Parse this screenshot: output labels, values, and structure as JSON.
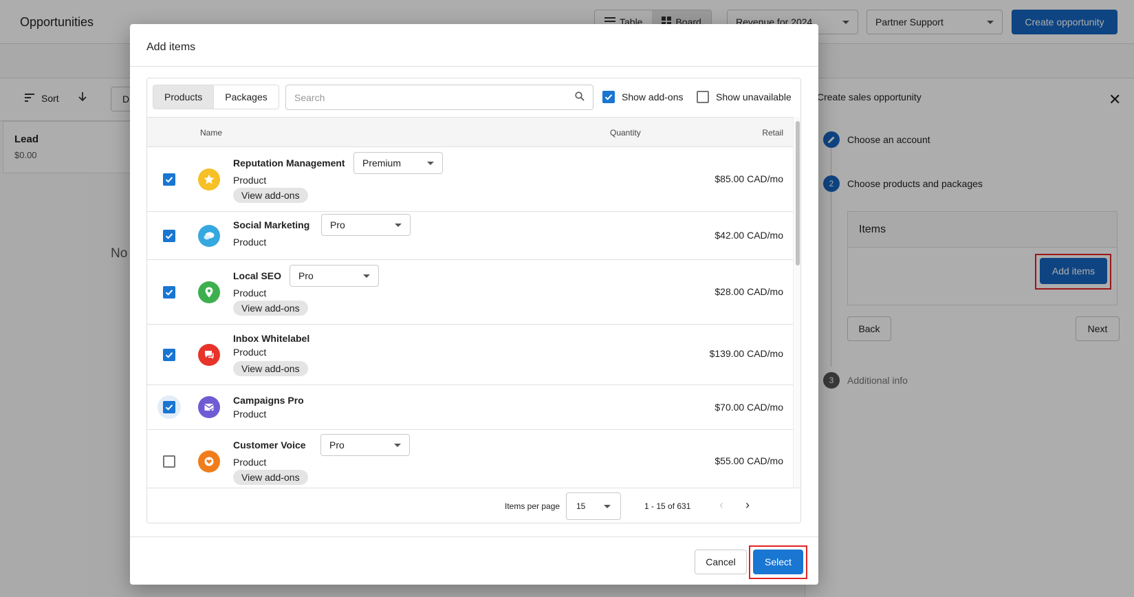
{
  "page": {
    "title": "Opportunities",
    "view_table": "Table",
    "view_board": "Board",
    "revenue_select": "Revenue for 2024",
    "team_select": "Partner Support",
    "create_button": "Create opportunity",
    "sort_label": "Sort",
    "filter_stub": "D",
    "lead_title": "Lead",
    "lead_amount": "$0.00",
    "empty_text": "No"
  },
  "side_panel": {
    "title": "Create sales opportunity",
    "steps": [
      {
        "number": "",
        "label": "Choose an account"
      },
      {
        "number": "2",
        "label": "Choose products and packages"
      },
      {
        "number": "3",
        "label": "Additional info"
      }
    ],
    "items_heading": "Items",
    "add_items_button": "Add items",
    "back_button": "Back",
    "next_button": "Next"
  },
  "modal": {
    "title": "Add items",
    "tabs": [
      "Products",
      "Packages"
    ],
    "search_placeholder": "Search",
    "show_addons_label": "Show add-ons",
    "show_addons_checked": true,
    "show_unavailable_label": "Show unavailable",
    "show_unavailable_checked": false,
    "columns": {
      "name": "Name",
      "quantity": "Quantity",
      "retail": "Retail"
    },
    "rows": [
      {
        "name": "Reputation Management",
        "type": "Product",
        "tier": "Premium",
        "addons": "View add-ons",
        "price": "$85.00 CAD/mo",
        "checked": true,
        "icon": "star-icon",
        "color": "#f6c026"
      },
      {
        "name": "Social Marketing",
        "type": "Product",
        "tier": "Pro",
        "addons": "",
        "price": "$42.00 CAD/mo",
        "checked": true,
        "icon": "chat-bubbles-icon",
        "color": "#35a8e0"
      },
      {
        "name": "Local SEO",
        "type": "Product",
        "tier": "Pro",
        "addons": "View add-ons",
        "price": "$28.00 CAD/mo",
        "checked": true,
        "icon": "map-pin-icon",
        "color": "#3daf4f"
      },
      {
        "name": "Inbox Whitelabel",
        "type": "Product",
        "tier": "",
        "addons": "View add-ons",
        "price": "$139.00 CAD/mo",
        "checked": true,
        "icon": "message-icon",
        "color": "#e8332a"
      },
      {
        "name": "Campaigns Pro",
        "type": "Product",
        "tier": "",
        "addons": "",
        "price": "$70.00 CAD/mo",
        "checked": true,
        "icon": "mail-check-icon",
        "color": "#6f5bd3"
      },
      {
        "name": "Customer Voice",
        "type": "Product",
        "tier": "Pro",
        "addons": "View add-ons",
        "price": "$55.00 CAD/mo",
        "checked": false,
        "icon": "heart-icon",
        "color": "#f07d1a"
      }
    ],
    "pager": {
      "label": "Items per page",
      "per_page": "15",
      "range": "1 - 15 of 631"
    },
    "cancel_button": "Cancel",
    "select_button": "Select"
  },
  "colors": {
    "primary": "#1565c0",
    "checkbox": "#1976d2",
    "highlight": "#e02424"
  }
}
